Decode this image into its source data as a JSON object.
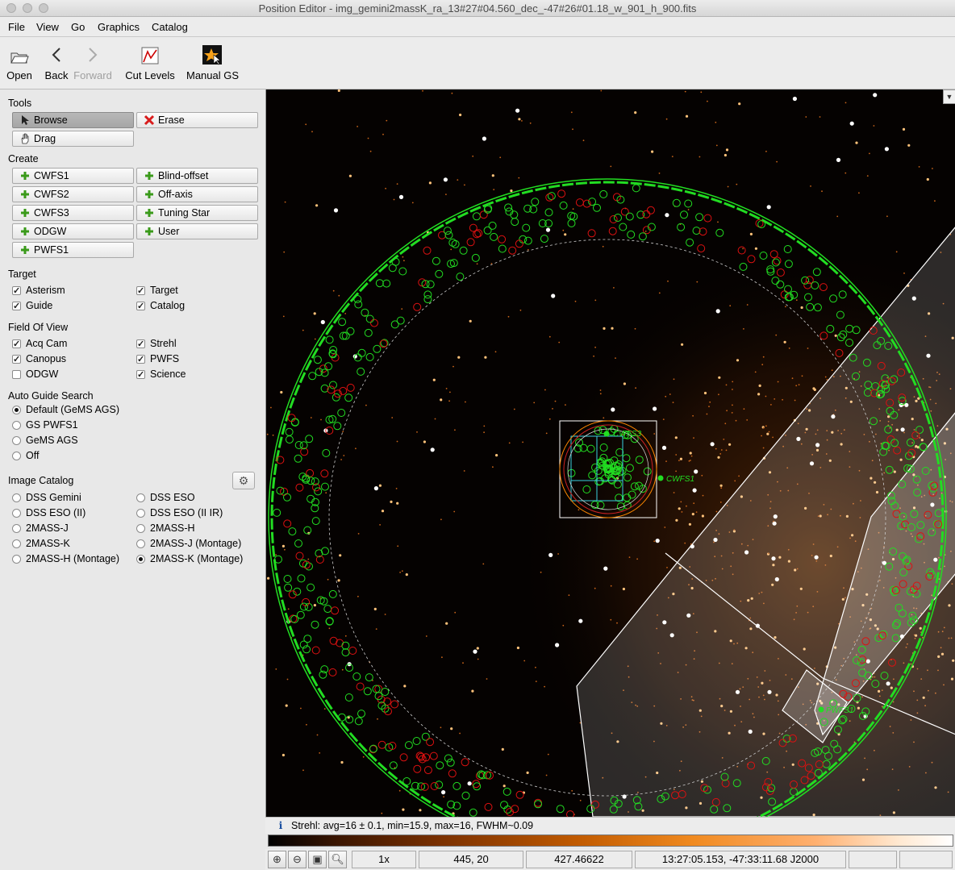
{
  "window": {
    "title": "Position Editor - img_gemini2massK_ra_13#27#04.560_dec_-47#26#01.18_w_901_h_900.fits"
  },
  "menu": [
    "File",
    "View",
    "Go",
    "Graphics",
    "Catalog"
  ],
  "toolbar": {
    "open": "Open",
    "back": "Back",
    "forward": "Forward",
    "cut_levels": "Cut Levels",
    "manual_gs": "Manual GS"
  },
  "tools": {
    "heading": "Tools",
    "browse": "Browse",
    "erase": "Erase",
    "drag": "Drag"
  },
  "create": {
    "heading": "Create",
    "buttons": [
      "CWFS1",
      "Blind-offset",
      "CWFS2",
      "Off-axis",
      "CWFS3",
      "Tuning Star",
      "ODGW",
      "User",
      "PWFS1"
    ]
  },
  "target": {
    "heading": "Target",
    "items": [
      {
        "label": "Asterism",
        "checked": true
      },
      {
        "label": "Target",
        "checked": true
      },
      {
        "label": "Guide",
        "checked": true
      },
      {
        "label": "Catalog",
        "checked": true
      }
    ]
  },
  "fov": {
    "heading": "Field Of View",
    "items": [
      {
        "label": "Acq Cam",
        "checked": true
      },
      {
        "label": "Strehl",
        "checked": true
      },
      {
        "label": "Canopus",
        "checked": true
      },
      {
        "label": "PWFS",
        "checked": true
      },
      {
        "label": "ODGW",
        "checked": false
      },
      {
        "label": "Science",
        "checked": true
      }
    ]
  },
  "ags": {
    "heading": "Auto Guide Search",
    "options": [
      {
        "label": "Default (GeMS AGS)",
        "selected": true
      },
      {
        "label": "GS PWFS1",
        "selected": false
      },
      {
        "label": "GeMS AGS",
        "selected": false
      },
      {
        "label": "Off",
        "selected": false
      }
    ]
  },
  "image_catalog": {
    "heading": "Image Catalog",
    "options": [
      {
        "label": "DSS Gemini",
        "selected": false
      },
      {
        "label": "DSS ESO",
        "selected": false
      },
      {
        "label": "DSS ESO (II)",
        "selected": false
      },
      {
        "label": "DSS ESO (II IR)",
        "selected": false
      },
      {
        "label": "2MASS-J",
        "selected": false
      },
      {
        "label": "2MASS-H",
        "selected": false
      },
      {
        "label": "2MASS-K",
        "selected": false
      },
      {
        "label": "2MASS-J (Montage)",
        "selected": false
      },
      {
        "label": "2MASS-H (Montage)",
        "selected": false
      },
      {
        "label": "2MASS-K (Montage)",
        "selected": true
      }
    ]
  },
  "image_labels": {
    "cwfs3": "CWFS3",
    "cwfs1": "CWFS1",
    "pwfs1": "PWFS1"
  },
  "status": {
    "icon": "info-icon",
    "text": "Strehl: avg=16 ± 0.1,  min=15.9,  max=16,  FWHM~0.09"
  },
  "bottom": {
    "zoom": "1x",
    "pixel": "445, 20",
    "value": "427.46622",
    "coords": "13:27:05.153, -47:33:11.68 J2000"
  },
  "colors": {
    "green": "#22dd22",
    "red": "#dd1111",
    "accent": "#ff8800"
  }
}
